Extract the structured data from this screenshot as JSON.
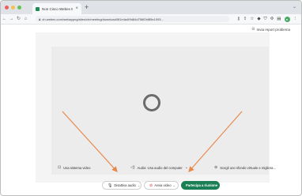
{
  "window": {
    "tab_title": "Non Cisco Webex Meetings fin...",
    "new_tab_glyph": "+",
    "url": "ch.webex.com/webappng/sites/ch/meeting/download/5f1e4a4f9d84d756f2b8f5e1093..."
  },
  "page": {
    "report_link": "Invia report problema"
  },
  "preview": {
    "options": {
      "system_video": "Usa sistema video",
      "audio": "Audio: Usa audio del computer",
      "background": "Scegli uno sfondo virtuale e migliora..."
    }
  },
  "controls": {
    "mute_audio": "Disattiva audio",
    "stop_video": "Avvia video",
    "join": "Partecipa a riunione"
  },
  "colors": {
    "join_button": "#1a7f54",
    "annotation_arrows": "#e8894a",
    "spinner": "#6b6b6b"
  }
}
